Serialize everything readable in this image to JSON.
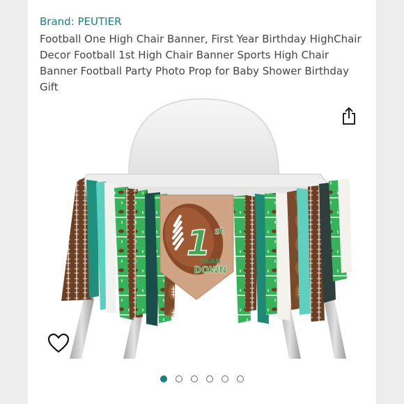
{
  "product": {
    "brand_label": "Brand: PEUTIER",
    "title": "Football One High Chair Banner, First Year Birthday HighChair Decor Football 1st High Chair Banner Sports High Chair Banner Football Party Photo Prop for Baby Shower Birthday Gift"
  },
  "banner": {
    "number": "1",
    "suffix": "st",
    "line1": "YEAR",
    "line2": "DOWN"
  },
  "icons": {
    "share": "share-icon",
    "wishlist": "heart-icon"
  },
  "carousel": {
    "total": 6,
    "active": 1
  },
  "colors": {
    "accent": "#1a7f85",
    "text": "#444444"
  }
}
